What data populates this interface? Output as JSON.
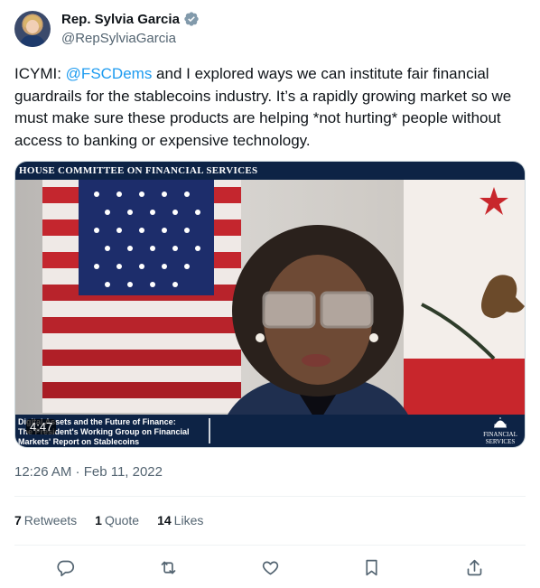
{
  "author": {
    "display_name": "Rep. Sylvia Garcia",
    "handle": "@RepSylviaGarcia",
    "verified_icon": "verified-badge-icon",
    "verified_color": "#829aab"
  },
  "tweet": {
    "text_before": "ICYMI: ",
    "mention": "@FSCDems",
    "text_after": " and I explored ways we can institute fair financial guardrails for the stablecoins industry. It’s a rapidly growing market so we must make sure these products are helping *not hurting* people without access to banking or expensive technology.",
    "mention_color": "#1d9bf0"
  },
  "video": {
    "banner_title": "HOUSE COMMITTEE ON FINANCIAL SERVICES",
    "caption_line1": "Digital Assets and the Future of Finance:",
    "caption_line2": "The President's Working Group on Financial",
    "caption_line3": "Markets' Report on Stablecoins",
    "logo_line1": "FINANCIAL",
    "logo_line2": "SERVICES",
    "duration": "4:47"
  },
  "timestamp": "12:26 AM · Feb 11, 2022",
  "stats": {
    "retweets_count": "7",
    "retweets_label": "Retweets",
    "quotes_count": "1",
    "quotes_label": "Quote",
    "likes_count": "14",
    "likes_label": "Likes"
  },
  "actions": [
    "reply-icon",
    "retweet-icon",
    "like-icon",
    "bookmark-icon",
    "share-icon"
  ]
}
